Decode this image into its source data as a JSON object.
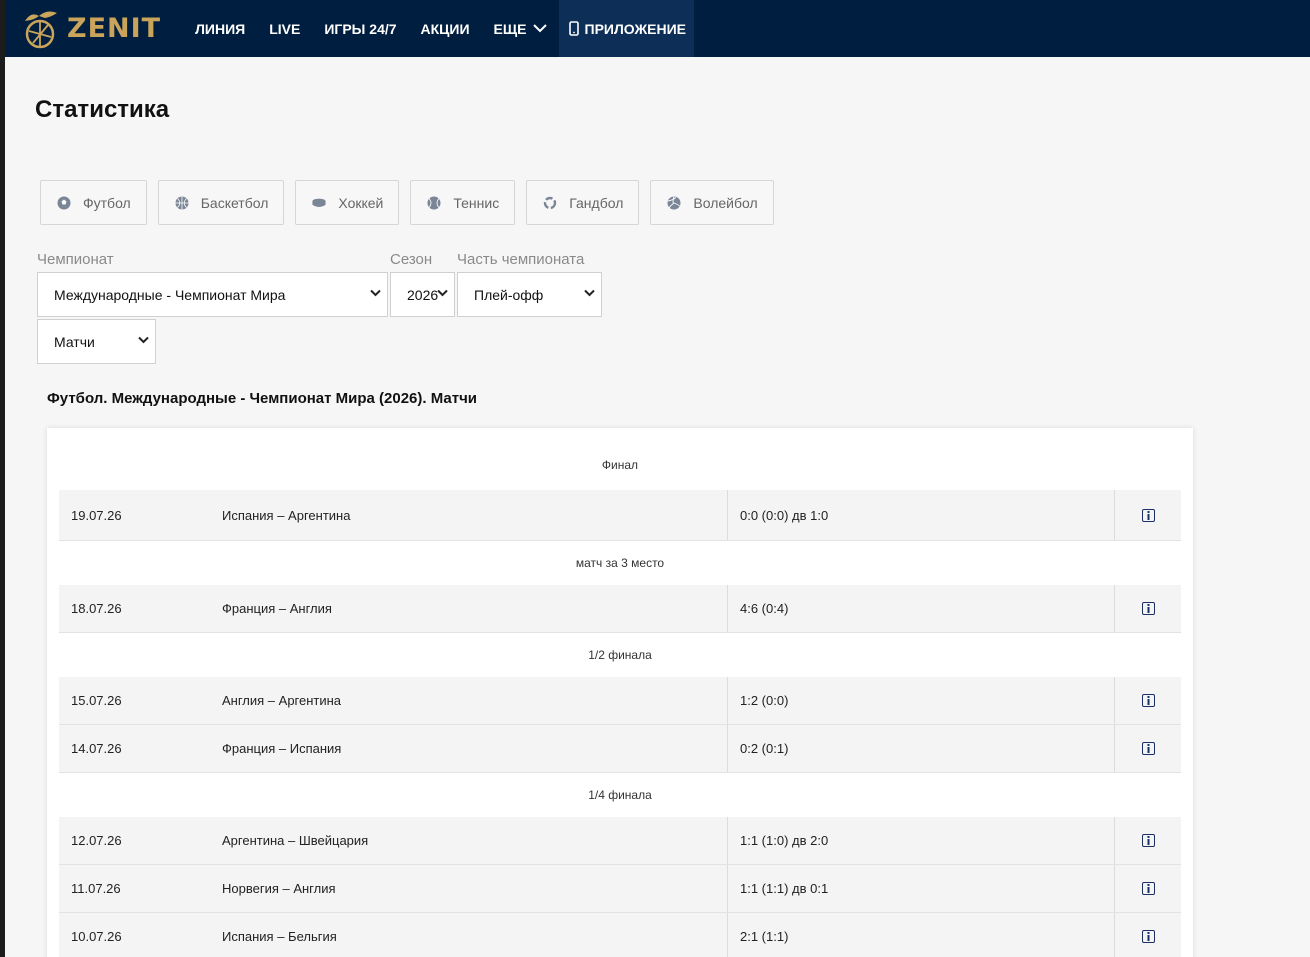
{
  "brand": {
    "logo_text": "ZENIT"
  },
  "nav": {
    "items": [
      {
        "label": "ЛИНИЯ"
      },
      {
        "label": "LIVE"
      },
      {
        "label": "ИГРЫ 24/7"
      },
      {
        "label": "АКЦИИ"
      },
      {
        "label": "ЕЩЕ"
      }
    ],
    "app_label": "ПРИЛОЖЕНИЕ"
  },
  "page_title": "Статистика",
  "sports": [
    {
      "label": "Футбол",
      "icon": "football-icon"
    },
    {
      "label": "Баскетбол",
      "icon": "basketball-icon"
    },
    {
      "label": "Хоккей",
      "icon": "puck-icon"
    },
    {
      "label": "Теннис",
      "icon": "tennis-ball-icon"
    },
    {
      "label": "Гандбол",
      "icon": "handball-icon"
    },
    {
      "label": "Волейбол",
      "icon": "volleyball-icon"
    }
  ],
  "filters": {
    "championship_label": "Чемпионат",
    "championship_value": "Международные - Чемпионат Мира",
    "season_label": "Сезон",
    "season_value": "2026",
    "part_label": "Часть чемпионата",
    "part_value": "Плей-офф",
    "view_value": "Матчи"
  },
  "table_title": "Футбол. Международные - Чемпионат Мира (2026). Матчи",
  "groups": [
    {
      "title": "Финал",
      "matches": [
        {
          "date": "19.07.26",
          "teams": "Испания – Аргентина",
          "score": "0:0 (0:0) дв 1:0"
        }
      ]
    },
    {
      "title": "матч за 3 место",
      "matches": [
        {
          "date": "18.07.26",
          "teams": "Франция – Англия",
          "score": "4:6 (0:4)"
        }
      ]
    },
    {
      "title": "1/2 финала",
      "matches": [
        {
          "date": "15.07.26",
          "teams": "Англия – Аргентина",
          "score": "1:2 (0:0)"
        },
        {
          "date": "14.07.26",
          "teams": "Франция – Испания",
          "score": "0:2 (0:1)"
        }
      ]
    },
    {
      "title": "1/4 финала",
      "matches": [
        {
          "date": "12.07.26",
          "teams": "Аргентина – Швейцария",
          "score": "1:1 (1:0) дв 2:0"
        },
        {
          "date": "11.07.26",
          "teams": "Норвегия – Англия",
          "score": "1:1 (1:1) дв 0:1"
        },
        {
          "date": "10.07.26",
          "teams": "Испания – Бельгия",
          "score": "2:1 (1:1)"
        }
      ]
    }
  ],
  "colors": {
    "header_bg": "#001e3f",
    "brand_gold": "#c9a45a",
    "app_btn_bg": "#0d2f57"
  }
}
